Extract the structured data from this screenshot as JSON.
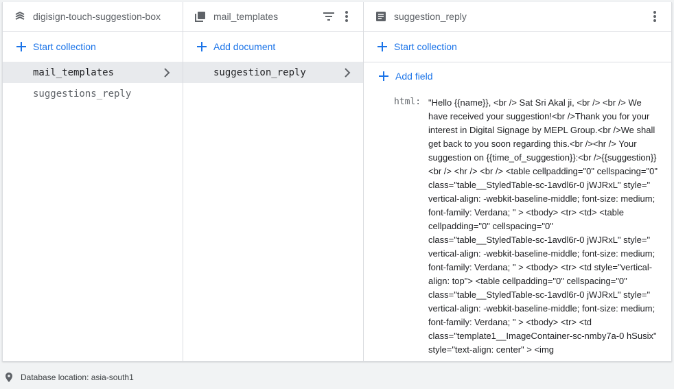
{
  "columns": {
    "root": {
      "title": "digisign-touch-suggestion-box",
      "add_label": "Start collection",
      "items": [
        {
          "label": "mail_templates"
        },
        {
          "label": "suggestions_reply"
        }
      ]
    },
    "collection": {
      "title": "mail_templates",
      "add_label": "Add document",
      "items": [
        {
          "label": "suggestion_reply"
        }
      ]
    },
    "document": {
      "title": "suggestion_reply",
      "add_collection_label": "Start collection",
      "add_field_label": "Add field",
      "field_key": "html:",
      "field_value": "\"Hello {{name}}, <br /> Sat Sri Akal ji, <br /> <br /> We have received your suggestion!<br />Thank you for your interest in Digital Signage by MEPL Group.<br />We shall get back to you soon regarding this.<br /><hr /> Your suggestion on {{time_of_suggestion}}:<br />{{suggestion}}<br /> <hr /> <br /> <table cellpadding=\"0\" cellspacing=\"0\" class=\"table__StyledTable-sc-1avdl6r-0 jWJRxL\" style=\" vertical-align: -webkit-baseline-middle; font-size: medium; font-family: Verdana; \" > <tbody> <tr> <td> <table cellpadding=\"0\" cellspacing=\"0\" class=\"table__StyledTable-sc-1avdl6r-0 jWJRxL\" style=\" vertical-align: -webkit-baseline-middle; font-size: medium; font-family: Verdana; \" > <tbody> <tr> <td style=\"vertical-align: top\"> <table cellpadding=\"0\" cellspacing=\"0\" class=\"table__StyledTable-sc-1avdl6r-0 jWJRxL\" style=\" vertical-align: -webkit-baseline-middle; font-size: medium; font-family: Verdana; \" > <tbody> <tr> <td class=\"template1__ImageContainer-sc-nmby7a-0 hSusix\" style=\"text-align: center\" > <img"
    }
  },
  "footer": {
    "label": "Database location: asia-south1"
  },
  "colors": {
    "accent": "#1a73e8",
    "selected_bg": "#e8eaed",
    "muted_text": "#5f6368",
    "border": "#dadce0"
  }
}
